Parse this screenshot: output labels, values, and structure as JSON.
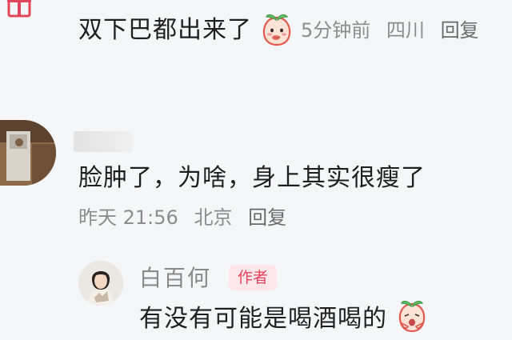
{
  "top_comment": {
    "text": "双下巴都出来了",
    "emoji_icon": "peach-blush-emoji",
    "time": "5分钟前",
    "location": "四川",
    "reply_label": "回复"
  },
  "main_comment": {
    "text": "脸肿了，为啥，身上其实很瘦了",
    "time": "昨天 21:56",
    "location": "北京",
    "reply_label": "回复"
  },
  "reply": {
    "username": "白百何",
    "badge": "作者",
    "text": "有没有可能是喝酒喝的",
    "emoji_icon": "peach-clap-emoji"
  },
  "colors": {
    "background": "#f5f6f7",
    "meta_text": "#8d8d8d",
    "author_badge_bg": "#fde7ea",
    "author_badge_text": "#e8425a"
  }
}
